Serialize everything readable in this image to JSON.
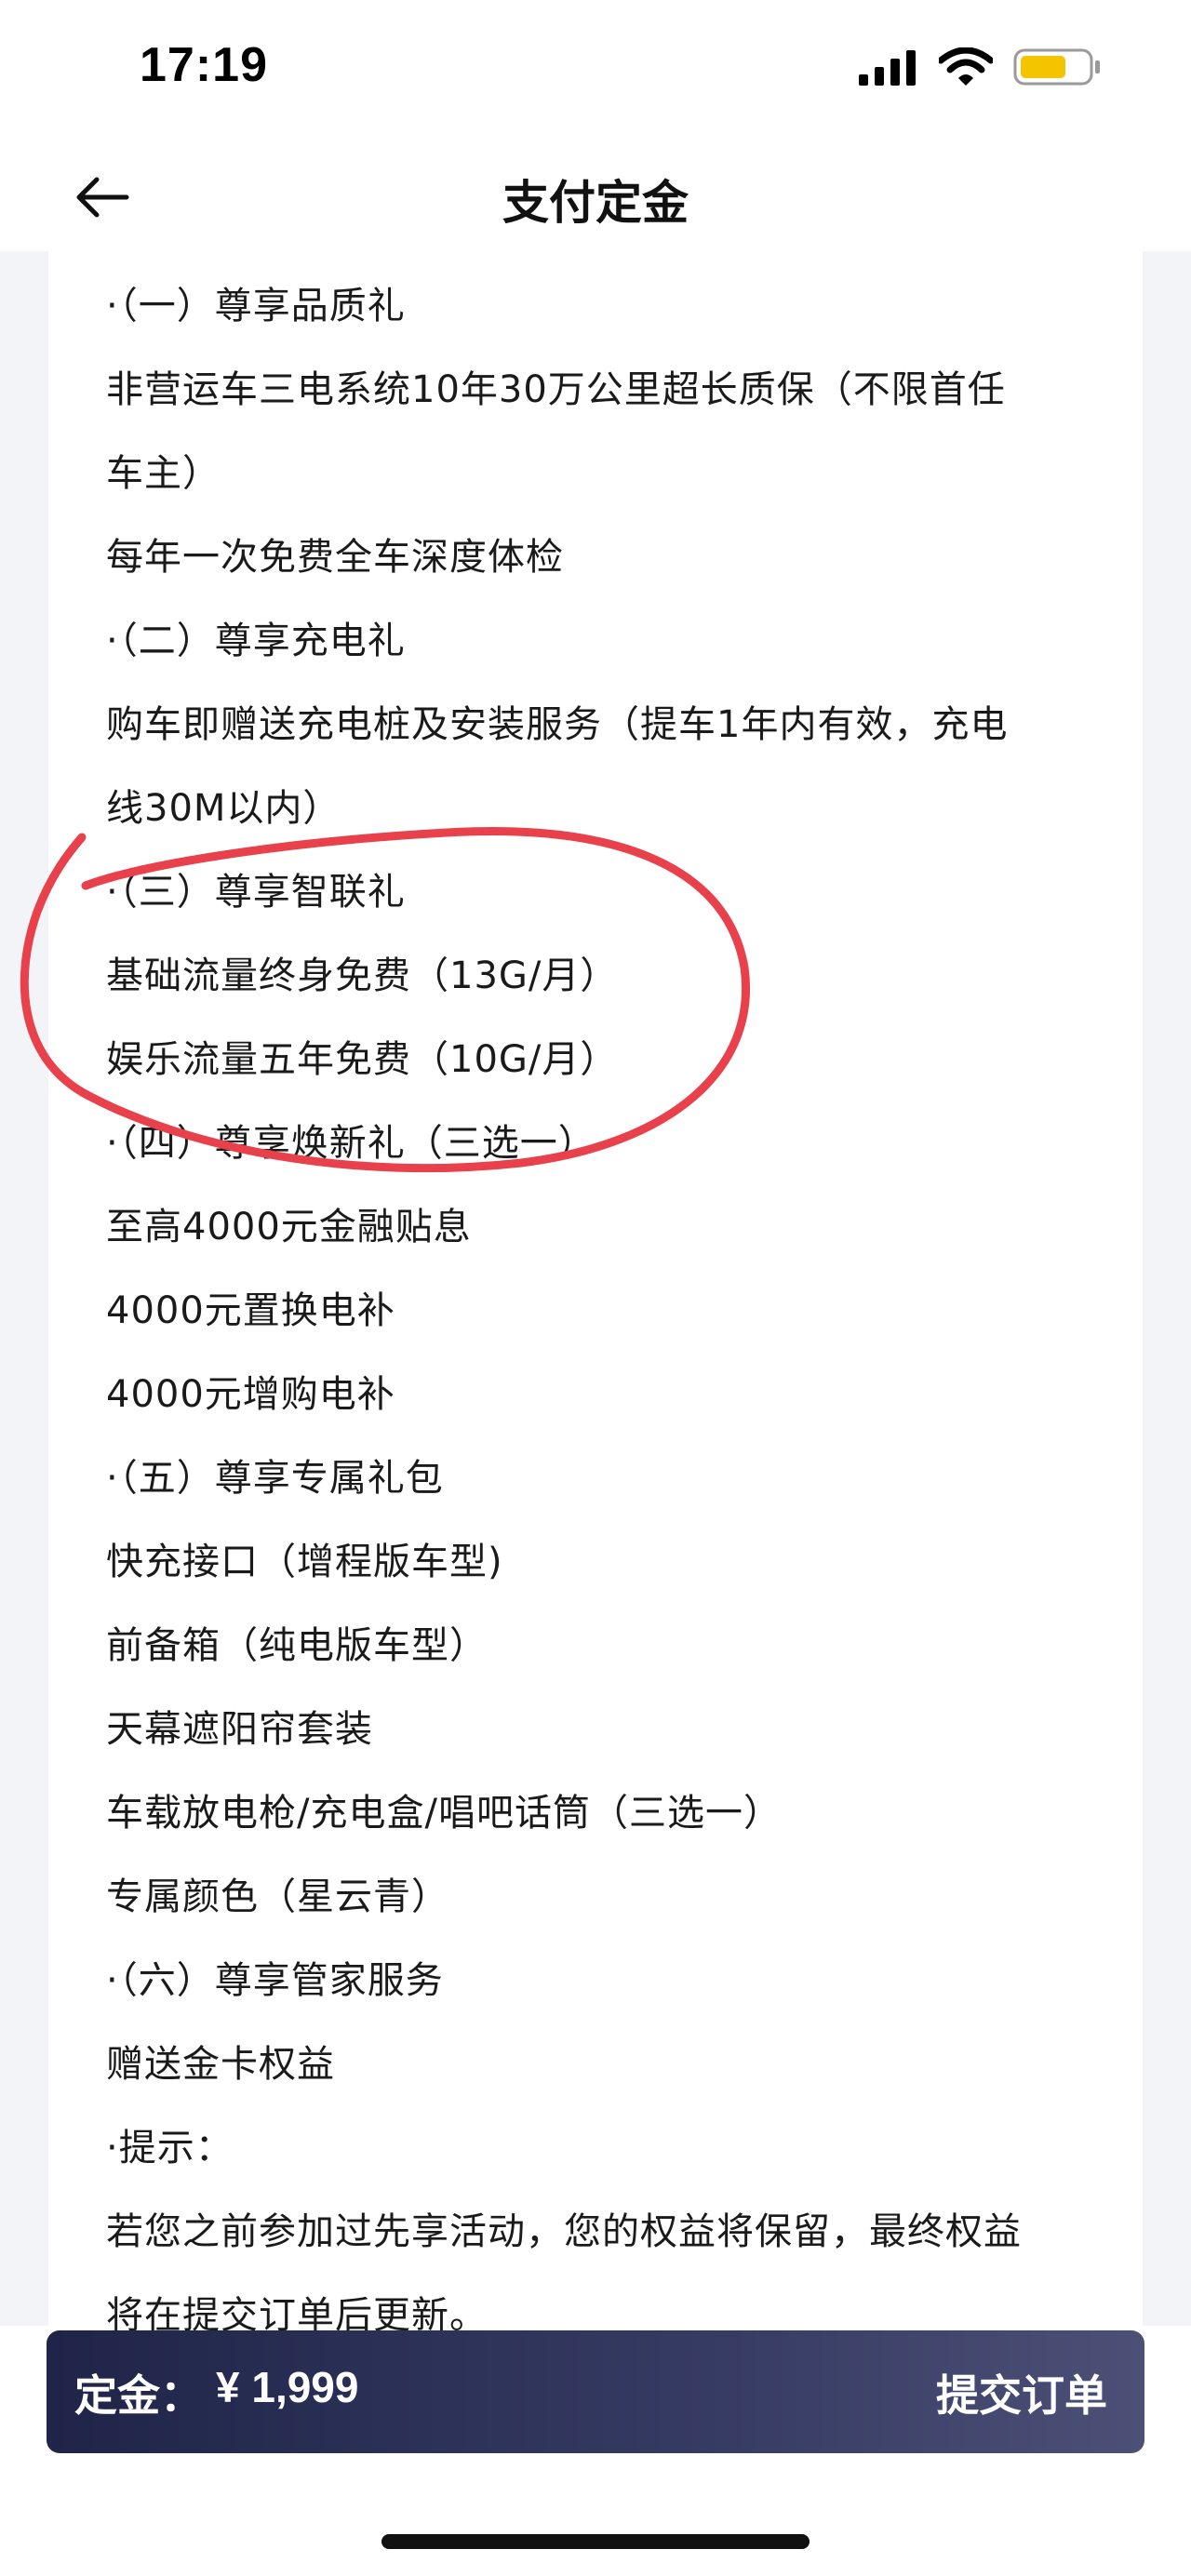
{
  "status_bar": {
    "time": "17:19",
    "battery_color": "#f5c400"
  },
  "nav": {
    "title": "支付定金"
  },
  "content": {
    "lines": [
      "·（一）尊享品质礼",
      "非营运车三电系统10年30万公里超长质保（不限首任",
      "车主）",
      "每年一次免费全车深度体检",
      "·（二）尊享充电礼",
      "购车即赠送充电桩及安装服务（提车1年内有效，充电",
      "线30M以内）",
      "·（三）尊享智联礼",
      "基础流量终身免费（13G/月）",
      "娱乐流量五年免费（10G/月）",
      "·（四）尊享焕新礼（三选一）",
      "至高4000元金融贴息",
      "4000元置换电补",
      "4000元增购电补",
      "·（五）尊享专属礼包",
      "快充接口（增程版车型)",
      "前备箱（纯电版车型）",
      "天幕遮阳帘套装",
      "车载放电枪/充电盒/唱吧话筒（三选一）",
      "专属颜色（星云青）",
      "·（六）尊享管家服务",
      "赠送金卡权益",
      "·提示：",
      "若您之前参加过先享活动，您的权益将保留，最终权益",
      "将在提交订单后更新。"
    ]
  },
  "footer": {
    "deposit_label": "定金：",
    "deposit_amount": "¥ 1,999",
    "submit_label": "提交订单"
  },
  "annotation": {
    "color": "#e8414b"
  }
}
